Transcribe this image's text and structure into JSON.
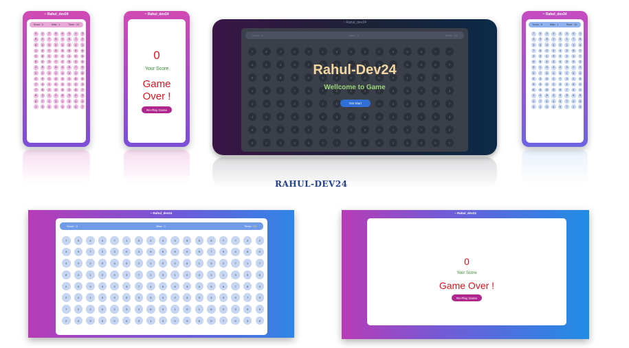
{
  "app_title": "~ Rahul_dev24",
  "brand": "Rahul-Dev24",
  "welcome": "Wellcome to Game",
  "get_start": "Get Start",
  "signature": "RAHUL-DEV24",
  "score_label": "Score : 0",
  "misses_label": "Miss : 1",
  "timer_label": "Timer :",
  "timer_value": "24",
  "game_over": {
    "score": "0",
    "label": "Your Score",
    "title": "Game Over !",
    "title_line1": "Game",
    "title_line2": "Over !",
    "replay": "Re-Play Game"
  },
  "colors": {
    "pink_gradient_start": "#d14ab4",
    "purple_gradient_end": "#7b4fd6",
    "blue_gradient_end": "#1f8de6",
    "accent_red": "#e0141f",
    "score_green": "#2c8a2a",
    "replay_button": "#b1268e",
    "start_button": "#2f6fd6",
    "brand_gold": "#f4d79f"
  },
  "mobile_grid_digits": [
    "5",
    "1",
    "7",
    "9",
    "6",
    "0",
    "1",
    "3",
    "8",
    "0",
    "7",
    "5",
    "4",
    "6",
    "7",
    "2",
    "8",
    "6",
    "5",
    "9",
    "3",
    "8",
    "4",
    "1",
    "1",
    "6",
    "7",
    "5",
    "9",
    "8",
    "6",
    "6",
    "2",
    "8",
    "1",
    "2",
    "2",
    "4",
    "0",
    "9",
    "5",
    "2",
    "3",
    "7",
    "2",
    "6",
    "2",
    "0",
    "3",
    "5",
    "7",
    "8",
    "4",
    "8",
    "7",
    "9",
    "9",
    "2",
    "3",
    "2",
    "4",
    "5",
    "1",
    "8",
    "2",
    "9",
    "0",
    "4",
    "3",
    "4",
    "8",
    "6",
    "7",
    "4",
    "1",
    "0",
    "3",
    "1",
    "2",
    "3",
    "7",
    "8",
    "2",
    "4",
    "6",
    "2",
    "6",
    "7",
    "8",
    "3",
    "1",
    "2",
    "6",
    "9",
    "0",
    "3",
    "8",
    "7",
    "1",
    "3",
    "1",
    "5",
    "0",
    "4",
    "1",
    "0",
    "4",
    "2",
    "4",
    "3",
    "0",
    "7"
  ],
  "desktop_grid_digits": [
    "7",
    "9",
    "4",
    "0",
    "7",
    "1",
    "0",
    "2",
    "4",
    "3",
    "5",
    "5",
    "5",
    "7",
    "7",
    "2",
    "2",
    "3",
    "9",
    "7",
    "2",
    "3",
    "0",
    "3",
    "6",
    "6",
    "5",
    "0",
    "5",
    "7",
    "9",
    "4",
    "8",
    "0",
    "4",
    "3",
    "2",
    "0",
    "4",
    "5",
    "2",
    "1",
    "0",
    "0",
    "6",
    "1",
    "3",
    "2",
    "7",
    "1",
    "7",
    "8",
    "2",
    "1",
    "2",
    "0",
    "3",
    "7",
    "2",
    "3",
    "1",
    "0",
    "4",
    "3",
    "1",
    "3",
    "5",
    "6",
    "2",
    "0",
    "3",
    "3",
    "2",
    "3",
    "7",
    "4",
    "9",
    "6",
    "3",
    "4",
    "5",
    "6",
    "7",
    "8",
    "3",
    "2",
    "4",
    "1",
    "5",
    "3",
    "5",
    "3",
    "5",
    "4",
    "2",
    "4",
    "3",
    "3",
    "3",
    "3",
    "7",
    "3",
    "7",
    "2",
    "2",
    "0",
    "2",
    "3",
    "3",
    "6",
    "3",
    "1",
    "0",
    "1",
    "6",
    "2",
    "3",
    "0",
    "5",
    "2",
    "4",
    "3",
    "5",
    "0",
    "6",
    "0",
    "1",
    "3",
    "0",
    "9",
    "6",
    "0",
    "7",
    "6",
    "3",
    "8",
    "2",
    "0",
    "4",
    "1",
    "1",
    "3",
    "2",
    "0",
    "1",
    "7",
    "0",
    "8",
    "3",
    "7",
    "7",
    "9",
    "7",
    "8",
    "9",
    "8",
    "3",
    "7",
    "2",
    "1",
    "0",
    "0",
    "2",
    "7",
    "2",
    "1",
    "4",
    "0",
    "3",
    "7",
    "4",
    "3",
    "5",
    "2",
    "9",
    "4",
    "6",
    "8",
    "1",
    "0",
    "9",
    "3",
    "1",
    "5",
    "9",
    "2",
    "9",
    "3",
    "3",
    "5",
    "2",
    "6",
    "5",
    "2",
    "0",
    "0",
    "2",
    "1",
    "4",
    "1",
    "2",
    "8",
    "7",
    "9",
    "0",
    "0",
    "1",
    "2",
    "0",
    "3",
    "3",
    "4",
    "0",
    "4",
    "2",
    "5",
    "6",
    "8",
    "3",
    "2",
    "4",
    "0",
    "2",
    "7"
  ]
}
